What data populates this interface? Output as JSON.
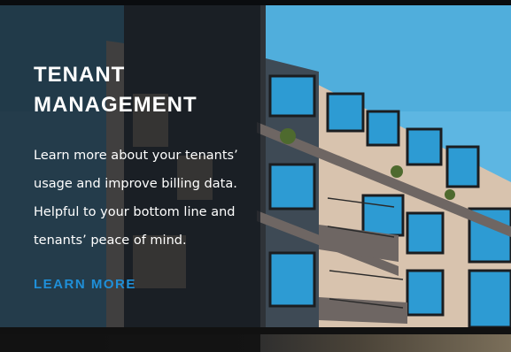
{
  "card": {
    "title_line1": "TENANT",
    "title_line2": "MANAGEMENT",
    "body_line1": "Learn more about your tenants’",
    "body_line2": "usage and improve billing data.",
    "body_line3": "Helpful to your bottom line and",
    "body_line4": "tenants’ peace of mind.",
    "cta_label": "LEARN MORE"
  },
  "colors": {
    "accent": "#1f8fd8",
    "panel_overlay": "#141a20",
    "sky": "#5fb8e3",
    "facade": "#d9c4b0"
  },
  "icons": {
    "hero_image": "apartment-building-photo"
  }
}
